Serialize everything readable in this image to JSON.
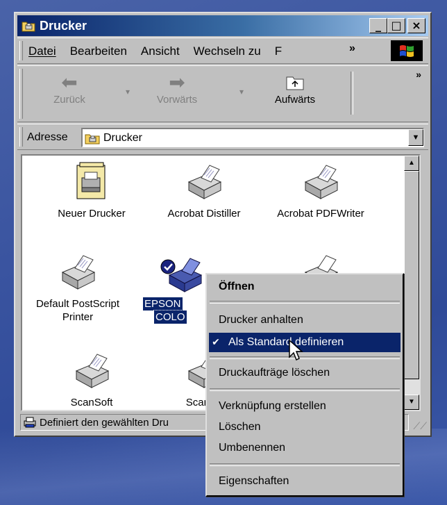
{
  "window": {
    "title": "Drucker",
    "buttons": {
      "minimize": "_",
      "maximize": "□",
      "close": "×"
    }
  },
  "menubar": {
    "items": [
      "Datei",
      "Bearbeiten",
      "Ansicht",
      "Wechseln zu",
      "F"
    ],
    "overflow": "»"
  },
  "toolbar": {
    "back_label": "Zurück",
    "forward_label": "Vorwärts",
    "up_label": "Aufwärts",
    "overflow": "»"
  },
  "addressbar": {
    "label": "Adresse",
    "value": "Drucker"
  },
  "printers": [
    {
      "label": "Neuer Drucker"
    },
    {
      "label": "Acrobat Distiller"
    },
    {
      "label": "Acrobat PDFWriter"
    },
    {
      "label": "Default PostScript Printer"
    },
    {
      "label": "EPSON",
      "label2": "COLO",
      "selected": true,
      "default": true
    },
    {
      "label": ""
    },
    {
      "label": "ScanSoft"
    },
    {
      "label": "ScanSo"
    }
  ],
  "statusbar": {
    "text": "Definiert den gewählten Dru"
  },
  "context_menu": {
    "items": [
      {
        "label": "Öffnen",
        "bold": true
      },
      {
        "label": "Drucker anhalten"
      },
      {
        "label": "Als Standard definieren",
        "checked": true,
        "highlighted": true
      },
      {
        "label": "Druckaufträge löschen"
      },
      {
        "label": "Verknüpfung erstellen"
      },
      {
        "label": "Löschen"
      },
      {
        "label": "Umbenennen"
      },
      {
        "label": "Eigenschaften"
      }
    ],
    "check_glyph": "✔"
  },
  "colors": {
    "title_gradient_start": "#0a246a",
    "title_gradient_end": "#a6caf0",
    "face": "#c0c0c0",
    "highlight": "#0a246a"
  }
}
